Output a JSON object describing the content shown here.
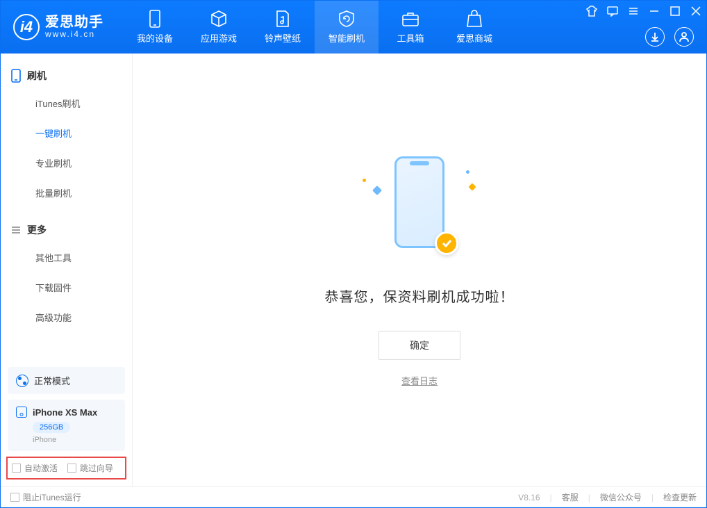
{
  "app": {
    "title": "爱思助手",
    "subtitle": "www.i4.cn"
  },
  "tabs": {
    "device": "我的设备",
    "apps": "应用游戏",
    "ringtones": "铃声壁纸",
    "flash": "智能刷机",
    "toolbox": "工具箱",
    "store": "爱思商城"
  },
  "sidebar": {
    "group_flash": "刷机",
    "items_flash": {
      "itunes": "iTunes刷机",
      "oneclick": "一键刷机",
      "pro": "专业刷机",
      "batch": "批量刷机"
    },
    "group_more": "更多",
    "items_more": {
      "other": "其他工具",
      "firmware": "下载固件",
      "advanced": "高级功能"
    }
  },
  "mode": {
    "label": "正常模式"
  },
  "device": {
    "name": "iPhone XS Max",
    "storage": "256GB",
    "type": "iPhone"
  },
  "options": {
    "auto_activate": "自动激活",
    "skip_guide": "跳过向导"
  },
  "main": {
    "success": "恭喜您，保资料刷机成功啦！",
    "ok": "确定",
    "view_log": "查看日志"
  },
  "footer": {
    "block_itunes": "阻止iTunes运行",
    "version": "V8.16",
    "support": "客服",
    "wechat": "微信公众号",
    "update": "检查更新"
  }
}
